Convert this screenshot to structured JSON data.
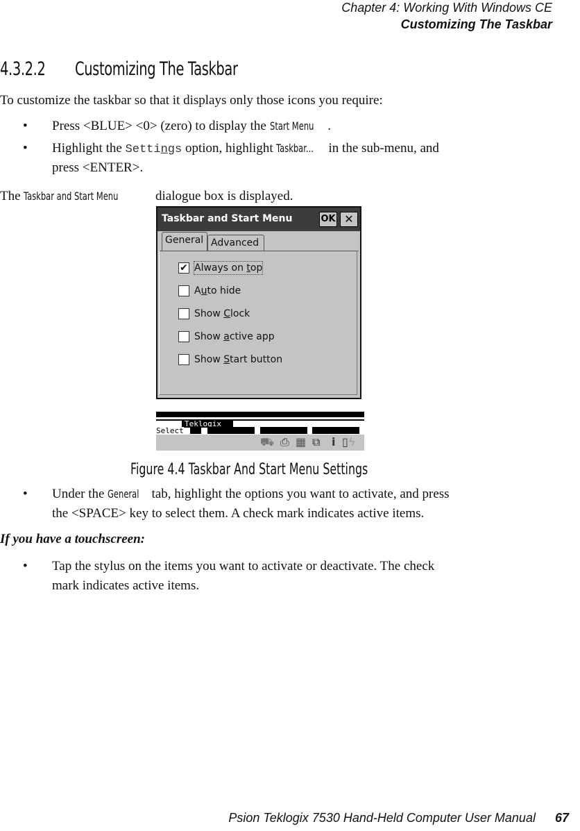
{
  "header": {
    "chapter": "Chapter  4:  Working With Windows CE",
    "section": "Customizing The Taskbar"
  },
  "section": {
    "number": "4.3.2.2",
    "title": "Customizing The Taskbar"
  },
  "intro": "To customize the taskbar so that it displays only those icons you require:",
  "steps": [
    {
      "bullet": "•",
      "pre": "Press <BLUE> <0> (zero) to display the ",
      "ui": "Start Menu",
      "post": "."
    },
    {
      "bullet": "•",
      "pre": "Highlight the ",
      "mono_pre": "Setti",
      "mono_u": "n",
      "mono_post": "gs",
      "mid": " option, highlight ",
      "ui": "Taskbar...",
      "post": " in the sub-menu, and",
      "line2": "press <ENTER>."
    }
  ],
  "displayed": {
    "pre": "The ",
    "ui": "Taskbar and Start Menu",
    "post": " dialogue box is displayed."
  },
  "dialog": {
    "title": "Taskbar and Start Menu",
    "ok_label": "OK",
    "close_label": "✕",
    "tabs": [
      {
        "label": "General",
        "active": true
      },
      {
        "label": "Advanced",
        "active": false
      }
    ],
    "options": [
      {
        "pre": "Always on ",
        "u": "t",
        "post": "op",
        "checked": true,
        "focused": true
      },
      {
        "pre": "A",
        "u": "u",
        "post": "to hide",
        "checked": false
      },
      {
        "pre": "Show ",
        "u": "C",
        "post": "lock",
        "checked": false
      },
      {
        "pre": "Show ",
        "u": "a",
        "post": "ctive app",
        "checked": false
      },
      {
        "pre": "Show ",
        "u": "S",
        "post": "tart button",
        "checked": false
      }
    ],
    "check_glyph": "✔"
  },
  "device_taskbar": {
    "banner": "Teklogix",
    "softkey_label": "Select",
    "tray_icons": [
      "network-icon",
      "printer-icon",
      "signal-icon",
      "connection-icon",
      "info-icon",
      "battery-icon"
    ]
  },
  "figure_caption": "Figure 4.4 Taskbar And Start Menu Settings",
  "general_step": {
    "bullet": "•",
    "pre": "Under the ",
    "ui": "General",
    "post": " tab, highlight the options you want to activate, and press",
    "line2": "the <SPACE> key to select them. A check mark indicates active items."
  },
  "touch_heading": "If you have a touchscreen:",
  "touch_step": {
    "bullet": "•",
    "line1": "Tap the stylus on the items you want to activate or deactivate. The check",
    "line2": "mark indicates active items."
  },
  "footer": {
    "manual": "Psion Teklogix 7530 Hand-Held Computer User Manual",
    "page": "67"
  }
}
